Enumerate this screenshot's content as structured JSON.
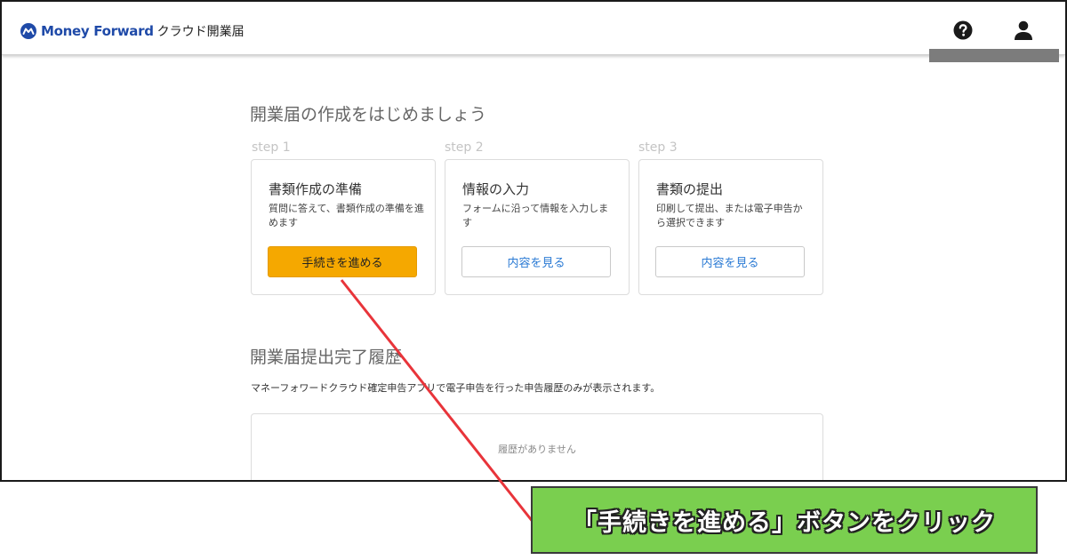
{
  "header": {
    "brand": "Money Forward",
    "service": "クラウド開業届",
    "help_icon": "question-circle-icon",
    "user_icon": "user-icon"
  },
  "main": {
    "title": "開業届の作成をはじめましょう",
    "steps": [
      {
        "step_label": "step 1",
        "title": "書類作成の準備",
        "description": "質問に答えて、書類作成の準備を進めます",
        "button_label": "手続きを進める"
      },
      {
        "step_label": "step 2",
        "title": "情報の入力",
        "description": "フォームに沿って情報を入力します",
        "button_label": "内容を見る"
      },
      {
        "step_label": "step 3",
        "title": "書類の提出",
        "description": "印刷して提出、または電子申告から選択できます",
        "button_label": "内容を見る"
      }
    ],
    "history_title": "開業届提出完了履歴",
    "history_note": "マネーフォワードクラウド確定申告アプリで電子申告を行った申告履歴のみが表示されます。",
    "history_empty": "履歴がありません"
  },
  "annotation": {
    "callout_text": "「手続きを進める」ボタンをクリック"
  },
  "colors": {
    "brand_blue": "#1f4aa8",
    "primary_button": "#f5a800",
    "link_blue": "#2a7ad4",
    "callout_green": "#7acf4f",
    "arrow_red": "#e8343a"
  }
}
